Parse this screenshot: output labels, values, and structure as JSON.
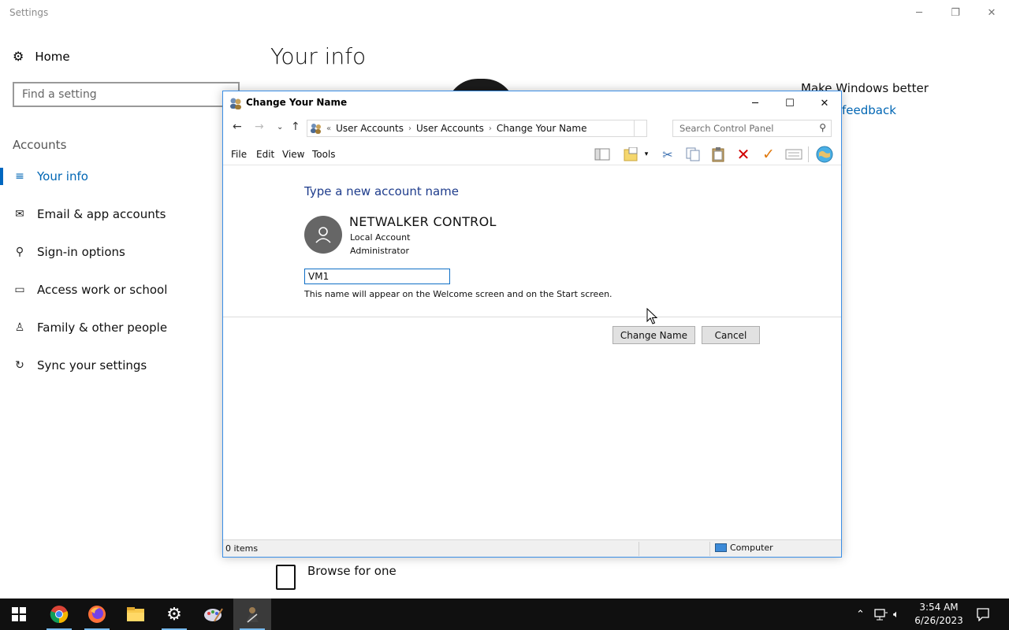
{
  "settings": {
    "window_title": "Settings",
    "home_label": "Home",
    "search_placeholder": "Find a setting",
    "section_header": "Accounts",
    "nav": [
      {
        "label": "Your info",
        "icon": "person-card-icon",
        "active": true
      },
      {
        "label": "Email & app accounts",
        "icon": "mail-icon"
      },
      {
        "label": "Sign-in options",
        "icon": "key-icon"
      },
      {
        "label": "Access work or school",
        "icon": "briefcase-icon"
      },
      {
        "label": "Family & other people",
        "icon": "person-add-icon"
      },
      {
        "label": "Sync your settings",
        "icon": "sync-icon"
      }
    ],
    "page_title": "Your info",
    "side_heading": "Make Windows better",
    "feedback_link": "feedback",
    "browse_label": "Browse for one"
  },
  "dialog": {
    "title": "Change Your Name",
    "breadcrumb": [
      "User Accounts",
      "User Accounts",
      "Change Your Name"
    ],
    "breadcrumb_prefix": "«",
    "search_placeholder": "Search Control Panel",
    "menu": [
      "File",
      "Edit",
      "View",
      "Tools"
    ],
    "heading": "Type a new account name",
    "account": {
      "name": "NETWALKER CONTROL",
      "type": "Local Account",
      "role": "Administrator"
    },
    "input_value": "VM1",
    "hint": "This name will appear on the Welcome screen and on the Start screen.",
    "buttons": {
      "change": "Change Name",
      "cancel": "Cancel"
    },
    "status": {
      "items": "0 items",
      "location": "Computer"
    }
  },
  "taskbar": {
    "apps": [
      "windows-start-icon",
      "chrome-icon",
      "firefox-icon",
      "file-explorer-icon",
      "settings-icon",
      "paint-icon",
      "user-accounts-icon"
    ],
    "time": "3:54 AM",
    "date": "6/26/2023"
  },
  "colors": {
    "accent": "#0066b4",
    "dialog_heading": "#1e3c8c",
    "taskbar": "#101010",
    "delete_red": "#d10000",
    "check_orange": "#e07a10"
  }
}
